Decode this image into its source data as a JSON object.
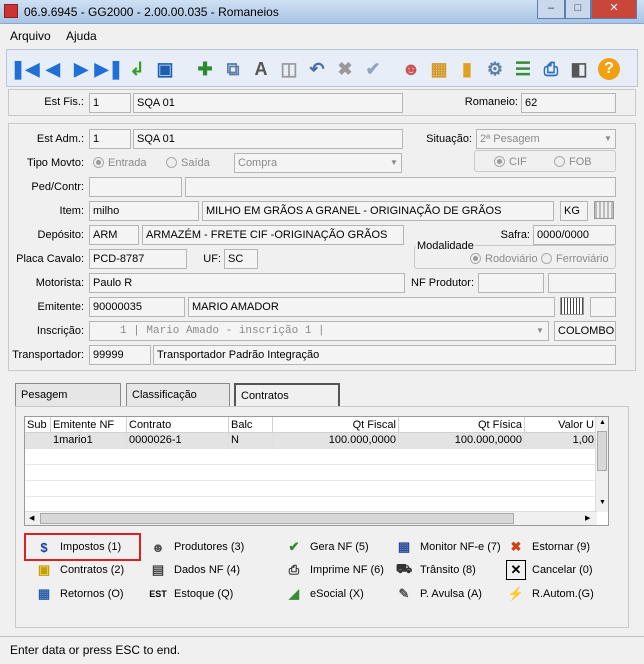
{
  "window": {
    "title": "06.9.6945 - GG2000 - 2.00.00.035 - Romaneios"
  },
  "menu": {
    "file": "Arquivo",
    "help": "Ajuda"
  },
  "header": {
    "est_fis_label": "Est Fis.:",
    "est_fis_code": "1",
    "est_fis_name": "SQA 01",
    "romaneio_label": "Romaneio:",
    "romaneio_value": "62"
  },
  "form": {
    "est_adm_label": "Est Adm.:",
    "est_adm_code": "1",
    "est_adm_name": "SQA 01",
    "situacao_label": "Situação:",
    "situacao_value": "2ª Pesagem",
    "tipo_movto_label": "Tipo Movto:",
    "entrada": "Entrada",
    "saida": "Saída",
    "tipo_select": "Compra",
    "cif": "CIF",
    "fob": "FOB",
    "ped_contr_label": "Ped/Contr:",
    "item_label": "Item:",
    "item_code": "milho",
    "item_desc": "MILHO EM GRÃOS A GRANEL - ORIGINAÇÃO DE GRÃOS",
    "item_unit": "KG",
    "deposito_label": "Depósito:",
    "deposito_code": "ARM",
    "deposito_desc": "ARMAZÉM - FRETE CIF -ORIGINAÇÃO GRÃOS",
    "safra_label": "Safra:",
    "safra_value": "0000/0000",
    "placa_label": "Placa Cavalo:",
    "placa_value": "PCD-8787",
    "uf_label": "UF:",
    "uf_value": "SC",
    "modalidade_label": "Modalidade",
    "rodoviario": "Rodoviário",
    "ferroviario": "Ferroviário",
    "motorista_label": "Motorista:",
    "motorista_value": "Paulo R",
    "nf_produtor_label": "NF Produtor:",
    "emitente_label": "Emitente:",
    "emitente_code": "90000035",
    "emitente_name": "MARIO AMADOR",
    "inscricao_label": "Inscrição:",
    "inscricao_value": "1 | Mario Amado - inscrição 1           |",
    "inscricao_city": "COLOMBO",
    "transportador_label": "Transportador:",
    "transportador_code": "99999",
    "transportador_name": "Transportador Padrão Integração"
  },
  "tabs": [
    "Pesagem",
    "Classificação",
    "Contratos"
  ],
  "grid": {
    "columns": [
      "Sub",
      "Emitente NF",
      "Contrato",
      "Balc",
      "Qt Fiscal",
      "Qt Física",
      "Valor U"
    ],
    "rows": [
      {
        "sub": "",
        "emitente": "1mario1",
        "contrato": "0000026-1",
        "balc": "N",
        "qt_fiscal": "100.000,0000",
        "qt_fisica": "100.000,0000",
        "valor": "1,00"
      }
    ]
  },
  "actions": [
    [
      "Impostos (1)",
      "Produtores (3)",
      "Gera NF (5)",
      "Monitor NF-e (7)",
      "Estornar (9)"
    ],
    [
      "Contratos (2)",
      "Dados NF (4)",
      "Imprime NF (6)",
      "Trânsito (8)",
      "Cancelar (0)"
    ],
    [
      "Retornos (O)",
      "Estoque (Q)",
      "eSocial (X)",
      "P. Avulsa (A)",
      "R.Autom.(G)"
    ]
  ],
  "status": "Enter data or press ESC to end."
}
